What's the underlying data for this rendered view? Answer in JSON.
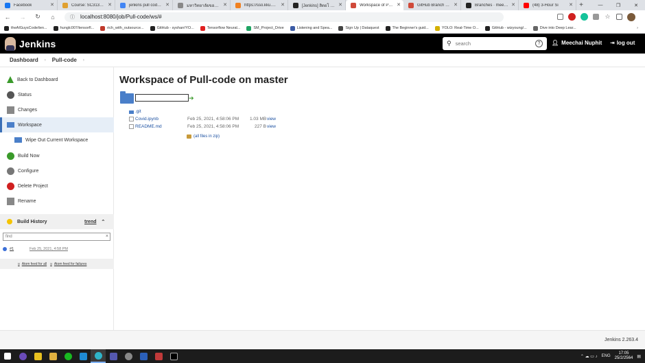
{
  "browser": {
    "tabs": [
      {
        "title": "Facebook",
        "color": "#1877f2",
        "active": false
      },
      {
        "title": "Course: SC313762:",
        "color": "#e0a030",
        "active": false
      },
      {
        "title": "jenkins pull code fr",
        "color": "#4285f4",
        "active": false
      },
      {
        "title": "มหาวิทยาลัยขอนแก่น",
        "color": "#888888",
        "active": false
      },
      {
        "title": "https://sso.kku.ac.th",
        "color": "#f08020",
        "active": false
      },
      {
        "title": "[Jenkins] สิตยโ Jenki",
        "color": "#222222",
        "active": false
      },
      {
        "title": "Workspace of Pull-c",
        "color": "#d04a3a",
        "active": true
      },
      {
        "title": "GitHub Branch Sou",
        "color": "#d04a3a",
        "active": false
      },
      {
        "title": "Branches · meecha",
        "color": "#222222",
        "active": false
      },
      {
        "title": "(48) 3-Hour Si",
        "color": "#ff0000",
        "active": false
      }
    ],
    "new_tab": "+",
    "window_controls": {
      "minimize": "—",
      "maximize": "❐",
      "close": "✕"
    },
    "address": "localhost:8080/job/Pull-code/ws/#",
    "bookmarks": [
      {
        "label": "theAIGuysCode/ten...",
        "color": "#222222"
      },
      {
        "label": "hunglc007/tensorfl...",
        "color": "#222222"
      },
      {
        "label": "rich_with_outsource...",
        "color": "#c0392b"
      },
      {
        "label": "GitHub - sysharr/YO...",
        "color": "#222222"
      },
      {
        "label": "Tensorflow Neural...",
        "color": "#e02020"
      },
      {
        "label": "SM_Project_Drive",
        "color": "#1fa463"
      },
      {
        "label": "Listening and Spea...",
        "color": "#3b5ba5"
      },
      {
        "label": "Sign Up | Dataquest",
        "color": "#444444"
      },
      {
        "label": "The Beginner's guid...",
        "color": "#222222"
      },
      {
        "label": "YOLO: Real-Time O...",
        "color": "#d4b000"
      },
      {
        "label": "GitHub - wizyoung/...",
        "color": "#222222"
      },
      {
        "label": "Dive into Deep Lear...",
        "color": "#666666"
      }
    ]
  },
  "jenkins": {
    "title": "Jenkins",
    "search_placeholder": "search",
    "help": "?",
    "user": "Meechai Nuphit",
    "logout": "log out",
    "version": "Jenkins 2.263.4"
  },
  "breadcrumb": {
    "root": "Dashboard",
    "job": "Pull-code",
    "sep": "›"
  },
  "sidebar": {
    "items": [
      {
        "label": "Back to Dashboard",
        "icon": "arrow-up-icon",
        "color": "#3a9a2a"
      },
      {
        "label": "Status",
        "icon": "search-icon",
        "color": "#555555"
      },
      {
        "label": "Changes",
        "icon": "notepad-icon",
        "color": "#888888"
      },
      {
        "label": "Workspace",
        "icon": "folder-icon",
        "color": "#4a7fc9"
      },
      {
        "label": "Wipe Out Current Workspace",
        "icon": "folder-delete-icon",
        "color": "#4a7fc9"
      },
      {
        "label": "Build Now",
        "icon": "clock-play-icon",
        "color": "#3a9a2a"
      },
      {
        "label": "Configure",
        "icon": "gear-icon",
        "color": "#777777"
      },
      {
        "label": "Delete Project",
        "icon": "no-entry-icon",
        "color": "#d02020"
      },
      {
        "label": "Rename",
        "icon": "notepad-icon",
        "color": "#888888"
      }
    ],
    "build_history": {
      "title": "Build History",
      "trend": "trend",
      "collapse": "⌃",
      "find_placeholder": "find",
      "clear": "×",
      "builds": [
        {
          "number": "#1",
          "date": "Feb 25, 2021, 4:58 PM"
        }
      ],
      "feed_all": "Atom feed for all",
      "feed_failures": "Atom feed for failures",
      "feed_icon": "ᴚ"
    }
  },
  "main": {
    "title": "Workspace of Pull-code on master",
    "files": [
      {
        "name": ".git",
        "type": "folder",
        "date": "",
        "size": "",
        "view": ""
      },
      {
        "name": "Covid.ipynb",
        "type": "file",
        "date": "Feb 25, 2021, 4:58:06 PM",
        "size": "1.03 MB",
        "view": "view"
      },
      {
        "name": "README.md",
        "type": "file",
        "date": "Feb 25, 2021, 4:58:06 PM",
        "size": "227 B",
        "view": "view"
      }
    ],
    "zip_label": "(all files in zip)"
  },
  "taskbar": {
    "lang": "ENG",
    "time": "17:05",
    "date": "25/2/2564",
    "tray_icons": "⌃ ☁ ▭ ♪",
    "notification": "▤"
  }
}
